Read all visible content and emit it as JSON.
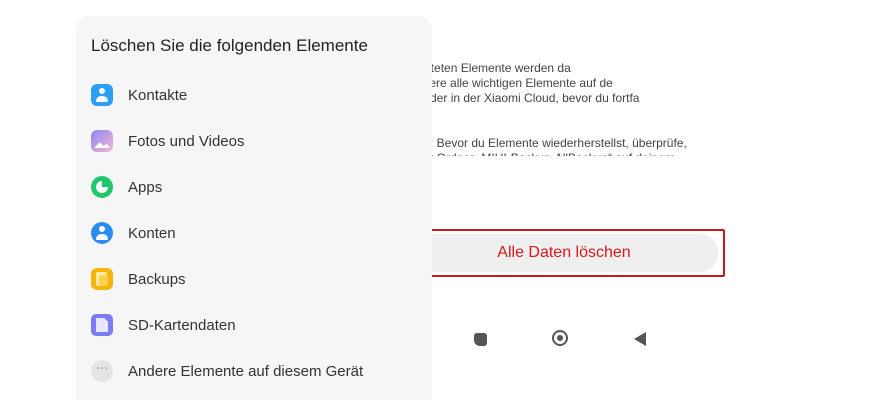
{
  "panel": {
    "title": "Löschen Sie die folgenden Elemente",
    "items": [
      {
        "label": "Kontakte",
        "icon": "contacts-icon"
      },
      {
        "label": "Fotos und Videos",
        "icon": "photos-icon"
      },
      {
        "label": "Apps",
        "icon": "apps-icon"
      },
      {
        "label": "Konten",
        "icon": "accounts-icon"
      },
      {
        "label": "Backups",
        "icon": "backups-icon"
      },
      {
        "label": "SD-Kartendaten",
        "icon": "sd-card-icon"
      },
      {
        "label": "Andere Elemente auf diesem Gerät",
        "icon": "more-icon"
      }
    ]
  },
  "info": {
    "paragraph1": "gelisteten Elemente werden da\nSichere alle wichtigen Elemente auf de\nter oder in der Xiaomi Cloud, bevor du fortfa",
    "paragraph2": "weis: Bevor du Elemente wiederherstellst, überprüfe,\no der Ordner „MIUI-Backup-AllBackup“ auf deinem\nnobilen Gerät existiert. Falls nicht, erstelle ihn."
  },
  "actions": {
    "delete_all_label": "Alle Daten löschen"
  },
  "colors": {
    "accent_red": "#d9181c",
    "highlight_border": "#c8191f"
  }
}
